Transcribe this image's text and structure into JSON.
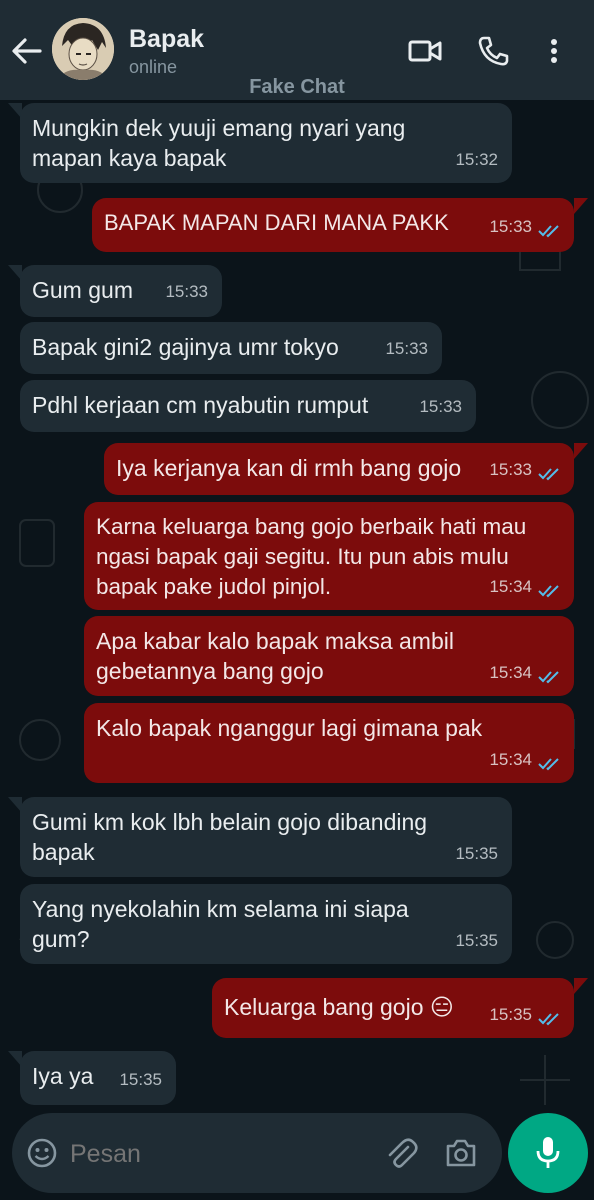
{
  "header": {
    "name": "Bapak",
    "status": "online",
    "watermark": "Fake Chat"
  },
  "composer": {
    "placeholder": "Pesan"
  },
  "messages": [
    {
      "dir": "in",
      "text": "Mungkin dek yuuji emang nyari yang mapan kaya bapak",
      "time": "15:32"
    },
    {
      "dir": "out",
      "text": "BAPAK MAPAN DARI MANA PAKK",
      "time": "15:33"
    },
    {
      "dir": "in",
      "text": "Gum gum",
      "time": "15:33"
    },
    {
      "dir": "in",
      "text": "Bapak gini2 gajinya umr tokyo",
      "time": "15:33"
    },
    {
      "dir": "in",
      "text": "Pdhl kerjaan cm nyabutin rumput",
      "time": "15:33"
    },
    {
      "dir": "out",
      "text": "Iya kerjanya kan di rmh bang gojo",
      "time": "15:33"
    },
    {
      "dir": "out",
      "text": "Karna keluarga bang gojo berbaik hati mau ngasi bapak gaji segitu. Itu pun abis mulu bapak pake judol pinjol.",
      "time": "15:34"
    },
    {
      "dir": "out",
      "text": "Apa kabar kalo bapak maksa ambil gebetannya bang gojo",
      "time": "15:34"
    },
    {
      "dir": "out",
      "text": "Kalo bapak nganggur lagi gimana pak",
      "time": "15:34"
    },
    {
      "dir": "in",
      "text": "Gumi km kok lbh belain gojo dibanding bapak",
      "time": "15:35"
    },
    {
      "dir": "in",
      "text": "Yang nyekolahin km selama ini siapa gum?",
      "time": "15:35"
    },
    {
      "dir": "out",
      "text": "Keluarga bang gojo 😑",
      "time": "15:35"
    },
    {
      "dir": "in",
      "text": "Iya ya",
      "time": "15:35"
    }
  ],
  "colors": {
    "incoming": "#1f2c34",
    "outgoing": "#7c0c0c",
    "read_tick": "#53bdeb",
    "accent": "#00a884"
  },
  "icons": [
    "back-arrow-icon",
    "video-call-icon",
    "phone-icon",
    "more-vertical-icon",
    "emoji-icon",
    "attach-icon",
    "camera-icon",
    "mic-icon",
    "double-check-icon"
  ]
}
